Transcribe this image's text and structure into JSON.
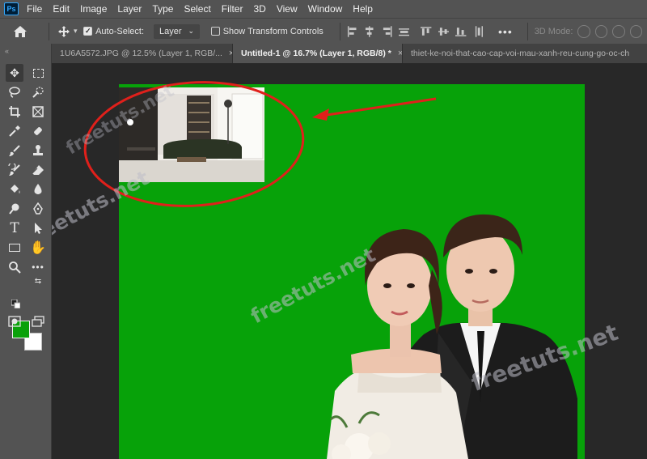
{
  "app": {
    "logo_text": "Ps",
    "menu": [
      "File",
      "Edit",
      "Image",
      "Layer",
      "Type",
      "Select",
      "Filter",
      "3D",
      "View",
      "Window",
      "Help"
    ]
  },
  "options_bar": {
    "auto_select_label": "Auto-Select:",
    "auto_select_checked": true,
    "auto_select_target": "Layer",
    "show_transform_label": "Show Transform Controls",
    "show_transform_checked": false,
    "more_label": "•••",
    "mode_3d_label": "3D Mode:"
  },
  "tabs": [
    {
      "label": "1U6A5572.JPG @ 12.5% (Layer 1, RGB/...",
      "active": false,
      "close": "×"
    },
    {
      "label": "Untitled-1 @ 16.7% (Layer 1, RGB/8) *",
      "active": true,
      "close": "×"
    },
    {
      "label": "thiet-ke-noi-that-cao-cap-voi-mau-xanh-reu-cung-go-oc-ch",
      "active": false,
      "close": ""
    }
  ],
  "toolbar": {
    "handle": "«",
    "tools": [
      "move-tool",
      "marquee-tool",
      "lasso-tool",
      "quick-selection-tool",
      "crop-tool",
      "frame-tool",
      "eyedropper-tool",
      "healing-brush-tool",
      "brush-tool",
      "clone-stamp-tool",
      "history-brush-tool",
      "eraser-tool",
      "paint-bucket-tool",
      "blur-tool",
      "dodge-tool",
      "pen-tool",
      "type-tool",
      "path-selection-tool",
      "rectangle-tool",
      "hand-tool",
      "zoom-tool",
      "edit-toolbar"
    ],
    "foreground_color": "#0aa10a",
    "background_color": "#ffffff"
  },
  "canvas": {
    "background_color": "#07a209",
    "annotation_color": "#e0201b"
  },
  "watermarks": [
    "freetuts.net",
    "freetuts.net",
    "freetuts.net",
    "freetuts.net"
  ]
}
